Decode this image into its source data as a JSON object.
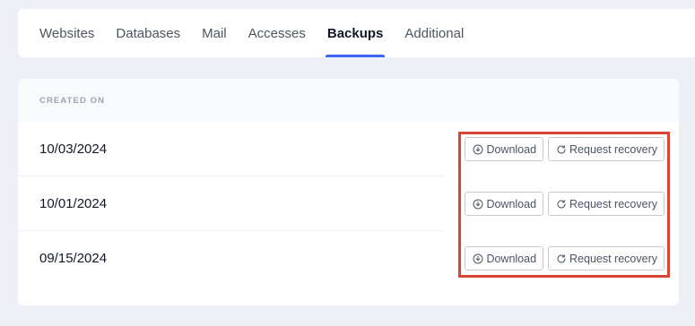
{
  "tabs": [
    {
      "label": "Websites",
      "active": false
    },
    {
      "label": "Databases",
      "active": false
    },
    {
      "label": "Mail",
      "active": false
    },
    {
      "label": "Accesses",
      "active": false
    },
    {
      "label": "Backups",
      "active": true
    },
    {
      "label": "Additional",
      "active": false
    }
  ],
  "table": {
    "column_header": "CREATED ON",
    "rows": [
      {
        "date": "10/03/2024",
        "download_label": "Download",
        "recovery_label": "Request recovery"
      },
      {
        "date": "10/01/2024",
        "download_label": "Download",
        "recovery_label": "Request recovery"
      },
      {
        "date": "09/15/2024",
        "download_label": "Download",
        "recovery_label": "Request recovery"
      }
    ]
  },
  "colors": {
    "accent": "#3b66f5",
    "highlight": "#d94535",
    "background": "#edf1f7"
  },
  "icons": {
    "download": "download-circle-icon",
    "recovery": "refresh-icon"
  }
}
